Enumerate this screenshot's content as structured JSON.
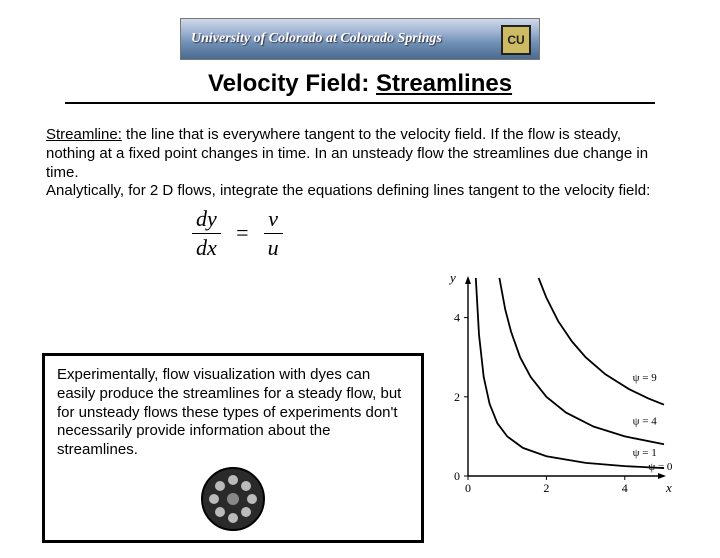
{
  "banner": {
    "text": "University of Colorado at Colorado Springs",
    "logo_text": "CU"
  },
  "title": {
    "prefix": "Velocity Field: ",
    "emph": "Streamlines"
  },
  "para": {
    "term": "Streamline:",
    "p1": " the line that is everywhere tangent to the velocity field.  If the flow is steady, nothing at a fixed point changes in time.  In an unsteady flow the streamlines due change in time.",
    "p2": "Analytically, for 2 D flows, integrate the equations defining lines tangent to the velocity field:"
  },
  "equation": {
    "lhs_num": "dy",
    "lhs_den": "dx",
    "rhs_num": "v",
    "rhs_den": "u"
  },
  "experiment": {
    "text": "Experimentally, flow visualization with dyes can easily produce the streamlines for a steady flow, but for unsteady flows these types of experiments don't necessarily provide information about the streamlines."
  },
  "chart_data": {
    "type": "line",
    "title": "",
    "xlabel": "x",
    "ylabel": "y",
    "xlim": [
      0,
      5
    ],
    "ylim": [
      0,
      5
    ],
    "x_ticks": [
      0,
      2,
      4
    ],
    "y_ticks": [
      0,
      2,
      4
    ],
    "annotations": [
      {
        "label": "ψ = 0",
        "x": 4.6,
        "y": 0.15
      },
      {
        "label": "ψ = 1",
        "x": 4.2,
        "y": 0.5
      },
      {
        "label": "ψ = 4",
        "x": 4.2,
        "y": 1.3
      },
      {
        "label": "ψ = 9",
        "x": 4.2,
        "y": 2.4
      }
    ],
    "series": [
      {
        "name": "psi=1",
        "x": [
          0.2,
          0.28,
          0.4,
          0.55,
          0.75,
          1.0,
          1.4,
          2.0,
          3.0,
          4.0,
          5.0
        ],
        "y": [
          5.0,
          3.57,
          2.5,
          1.82,
          1.33,
          1.0,
          0.71,
          0.5,
          0.33,
          0.25,
          0.2
        ]
      },
      {
        "name": "psi=4",
        "x": [
          0.8,
          0.95,
          1.1,
          1.33,
          1.6,
          2.0,
          2.5,
          3.2,
          4.0,
          5.0
        ],
        "y": [
          5.0,
          4.21,
          3.64,
          3.0,
          2.5,
          2.0,
          1.6,
          1.25,
          1.0,
          0.8
        ]
      },
      {
        "name": "psi=9",
        "x": [
          1.8,
          2.0,
          2.3,
          2.65,
          3.0,
          3.5,
          4.1,
          4.6,
          5.0
        ],
        "y": [
          5.0,
          4.5,
          3.91,
          3.4,
          3.0,
          2.57,
          2.2,
          1.96,
          1.8
        ]
      }
    ]
  }
}
